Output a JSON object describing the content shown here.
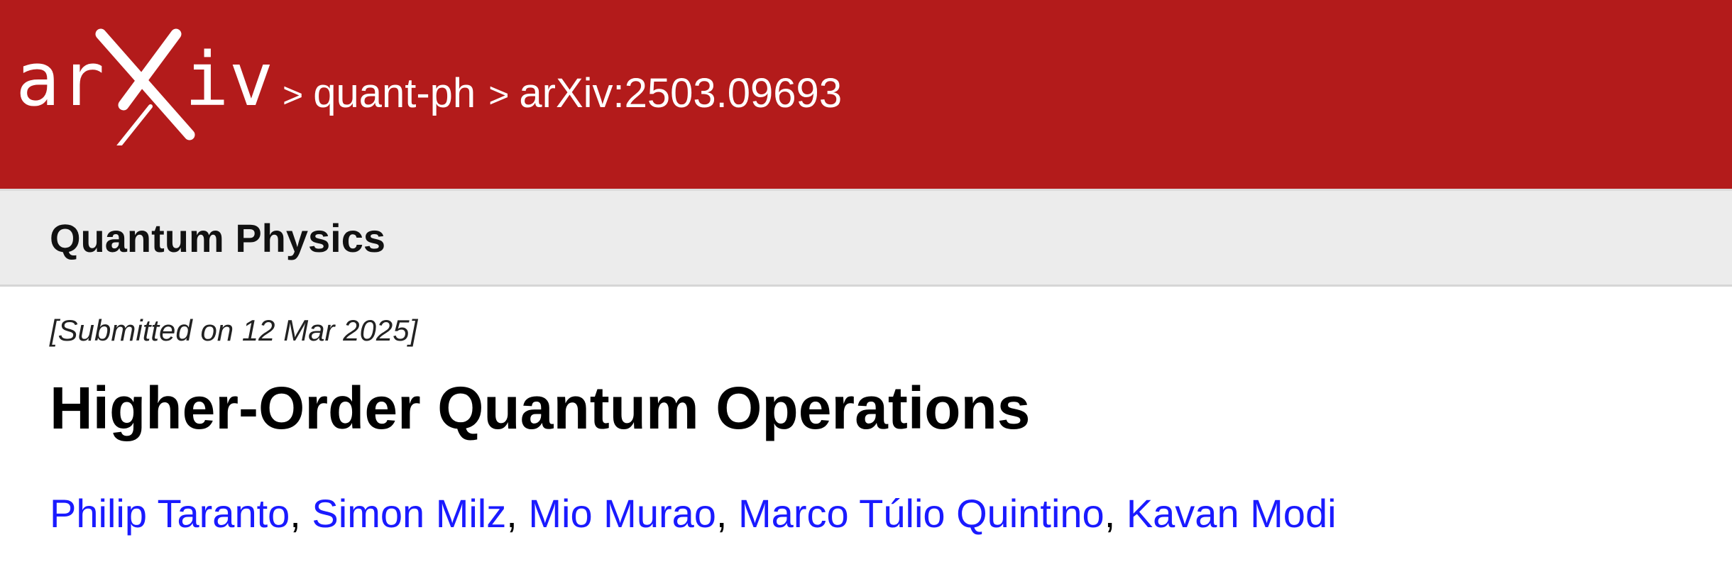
{
  "header": {
    "logo_text": "arXiv",
    "breadcrumbs": {
      "separator": ">",
      "category": "quant-ph",
      "paper_id": "arXiv:2503.09693"
    },
    "background_color": "#b31b1b"
  },
  "subheader": {
    "subject": "Quantum Physics",
    "background_color": "#ececec"
  },
  "paper": {
    "submission": "[Submitted on 12 Mar 2025]",
    "title": "Higher-Order Quantum Operations",
    "authors": [
      "Philip Taranto",
      "Simon Milz",
      "Mio Murao",
      "Marco Túlio Quintino",
      "Kavan Modi"
    ],
    "author_separator": ",",
    "link_color": "#1a1aff"
  }
}
